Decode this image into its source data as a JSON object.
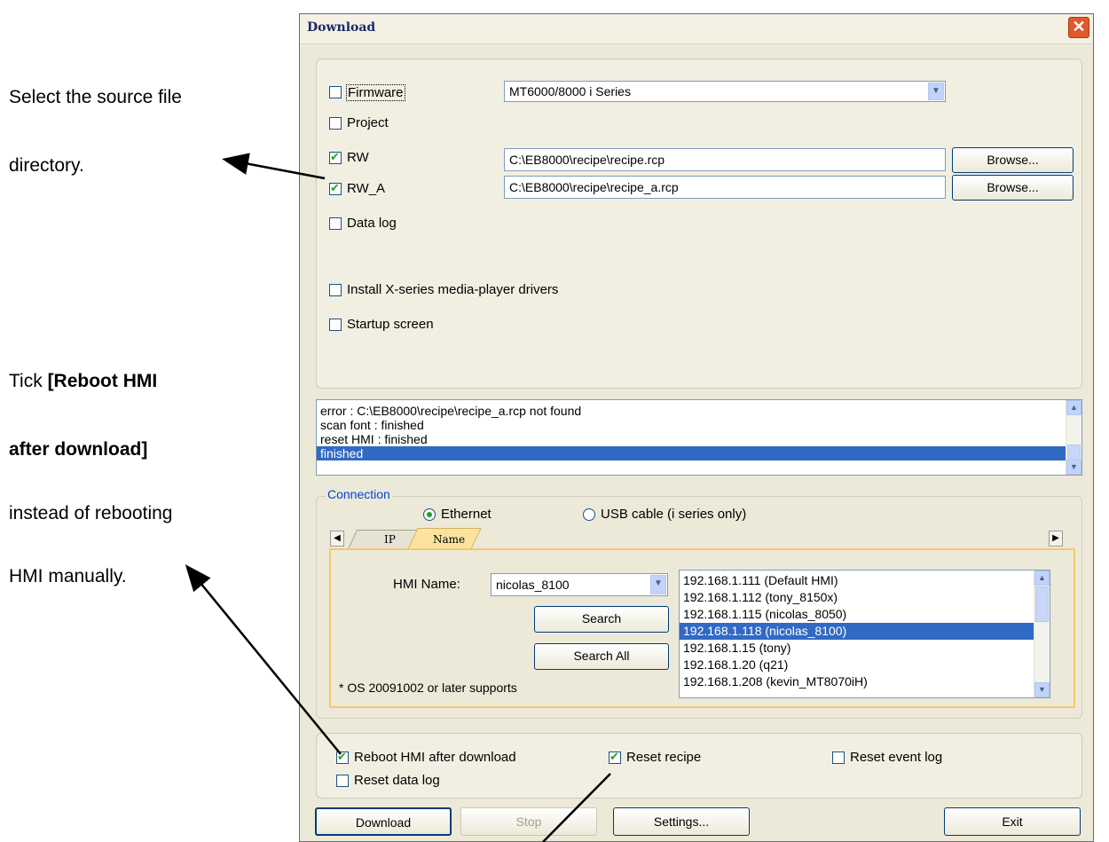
{
  "annotations": {
    "select_line1": "Select the source file",
    "select_line2": "directory.",
    "tick_word": "Tick",
    "reboot_bold1": "[Reboot HMI",
    "reboot_bold2": "after download]",
    "instead_line": "instead of rebooting",
    "manual_line": "HMI manually."
  },
  "dialog": {
    "title": "Download",
    "close": "✕"
  },
  "options": {
    "firmware": {
      "label": "Firmware",
      "checked": false,
      "select_value": "MT6000/8000 i Series"
    },
    "project": {
      "label": "Project",
      "checked": false
    },
    "rw": {
      "label": "RW",
      "checked": true,
      "path": "C:\\EB8000\\recipe\\recipe.rcp",
      "browse": "Browse..."
    },
    "rw_a": {
      "label": "RW_A",
      "checked": true,
      "path": "C:\\EB8000\\recipe\\recipe_a.rcp",
      "browse": "Browse..."
    },
    "data_log": {
      "label": "Data log",
      "checked": false
    },
    "install_x": {
      "label": "Install X-series media-player drivers",
      "checked": false
    },
    "startup": {
      "label": "Startup screen",
      "checked": false
    }
  },
  "log": [
    "error : C:\\EB8000\\recipe\\recipe_a.rcp not found",
    "scan font : finished",
    "reset HMI : finished",
    "finished"
  ],
  "connection": {
    "legend": "Connection",
    "ethernet": "Ethernet",
    "usb": "USB cable (i series only)",
    "tab_ip": "IP",
    "tab_name": "Name",
    "hmi_name_label": "HMI Name:",
    "hmi_name_value": "nicolas_8100",
    "search": "Search",
    "search_all": "Search All",
    "os_note": "* OS 20091002 or later supports",
    "hmi_list": [
      "192.168.1.111 (Default HMI)",
      "192.168.1.112 (tony_8150x)",
      "192.168.1.115 (nicolas_8050)",
      "192.168.1.118 (nicolas_8100)",
      "192.168.1.15 (tony)",
      "192.168.1.20 (q21)",
      "192.168.1.208 (kevin_MT8070iH)"
    ]
  },
  "after": {
    "reboot": {
      "label": "Reboot HMI after download",
      "checked": true
    },
    "reset_recipe": {
      "label": "Reset recipe",
      "checked": true
    },
    "reset_event": {
      "label": "Reset event log",
      "checked": false
    },
    "reset_data": {
      "label": "Reset data log",
      "checked": false
    }
  },
  "buttons": {
    "download": "Download",
    "stop": "Stop",
    "settings": "Settings...",
    "exit": "Exit"
  }
}
